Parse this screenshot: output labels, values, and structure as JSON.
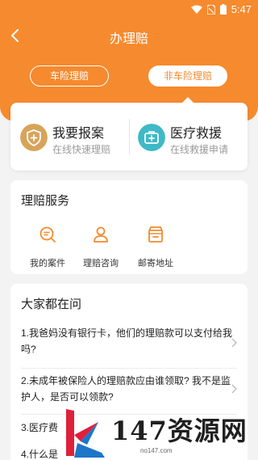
{
  "statusbar": {
    "time": "5:47"
  },
  "header": {
    "title": "办理赔"
  },
  "tabs": [
    {
      "label": "车险理赔"
    },
    {
      "label": "非车险理赔"
    }
  ],
  "actions": [
    {
      "title": "我要报案",
      "subtitle": "在线快速理赔",
      "icon": "shield-plus-icon"
    },
    {
      "title": "医疗救援",
      "subtitle": "在线救援申请",
      "icon": "medical-kit-icon"
    }
  ],
  "services": {
    "heading": "理赔服务",
    "items": [
      {
        "label": "我的案件",
        "icon": "search-case-icon"
      },
      {
        "label": "理赔咨询",
        "icon": "person-icon"
      },
      {
        "label": "邮寄地址",
        "icon": "mailbox-icon"
      }
    ]
  },
  "faq": {
    "heading": "大家都在问",
    "items": [
      {
        "line1": "1.我爸妈没有银行卡，他们的理赔款可以支付给我",
        "line2": "吗?"
      },
      {
        "line1": "2.未成年被保险人的理赔款应由谁领取? 我不是监",
        "line2": "护人，是否可以领款?"
      },
      {
        "line1": "3.医疗费",
        "line2": ""
      },
      {
        "line1": "4.什么是",
        "line2": ""
      }
    ]
  },
  "watermark": {
    "text": "147资源网",
    "url": "no147.com"
  },
  "colors": {
    "brand": "#f68a2e",
    "gold": "#d7a45a",
    "teal": "#3fb9c7"
  }
}
